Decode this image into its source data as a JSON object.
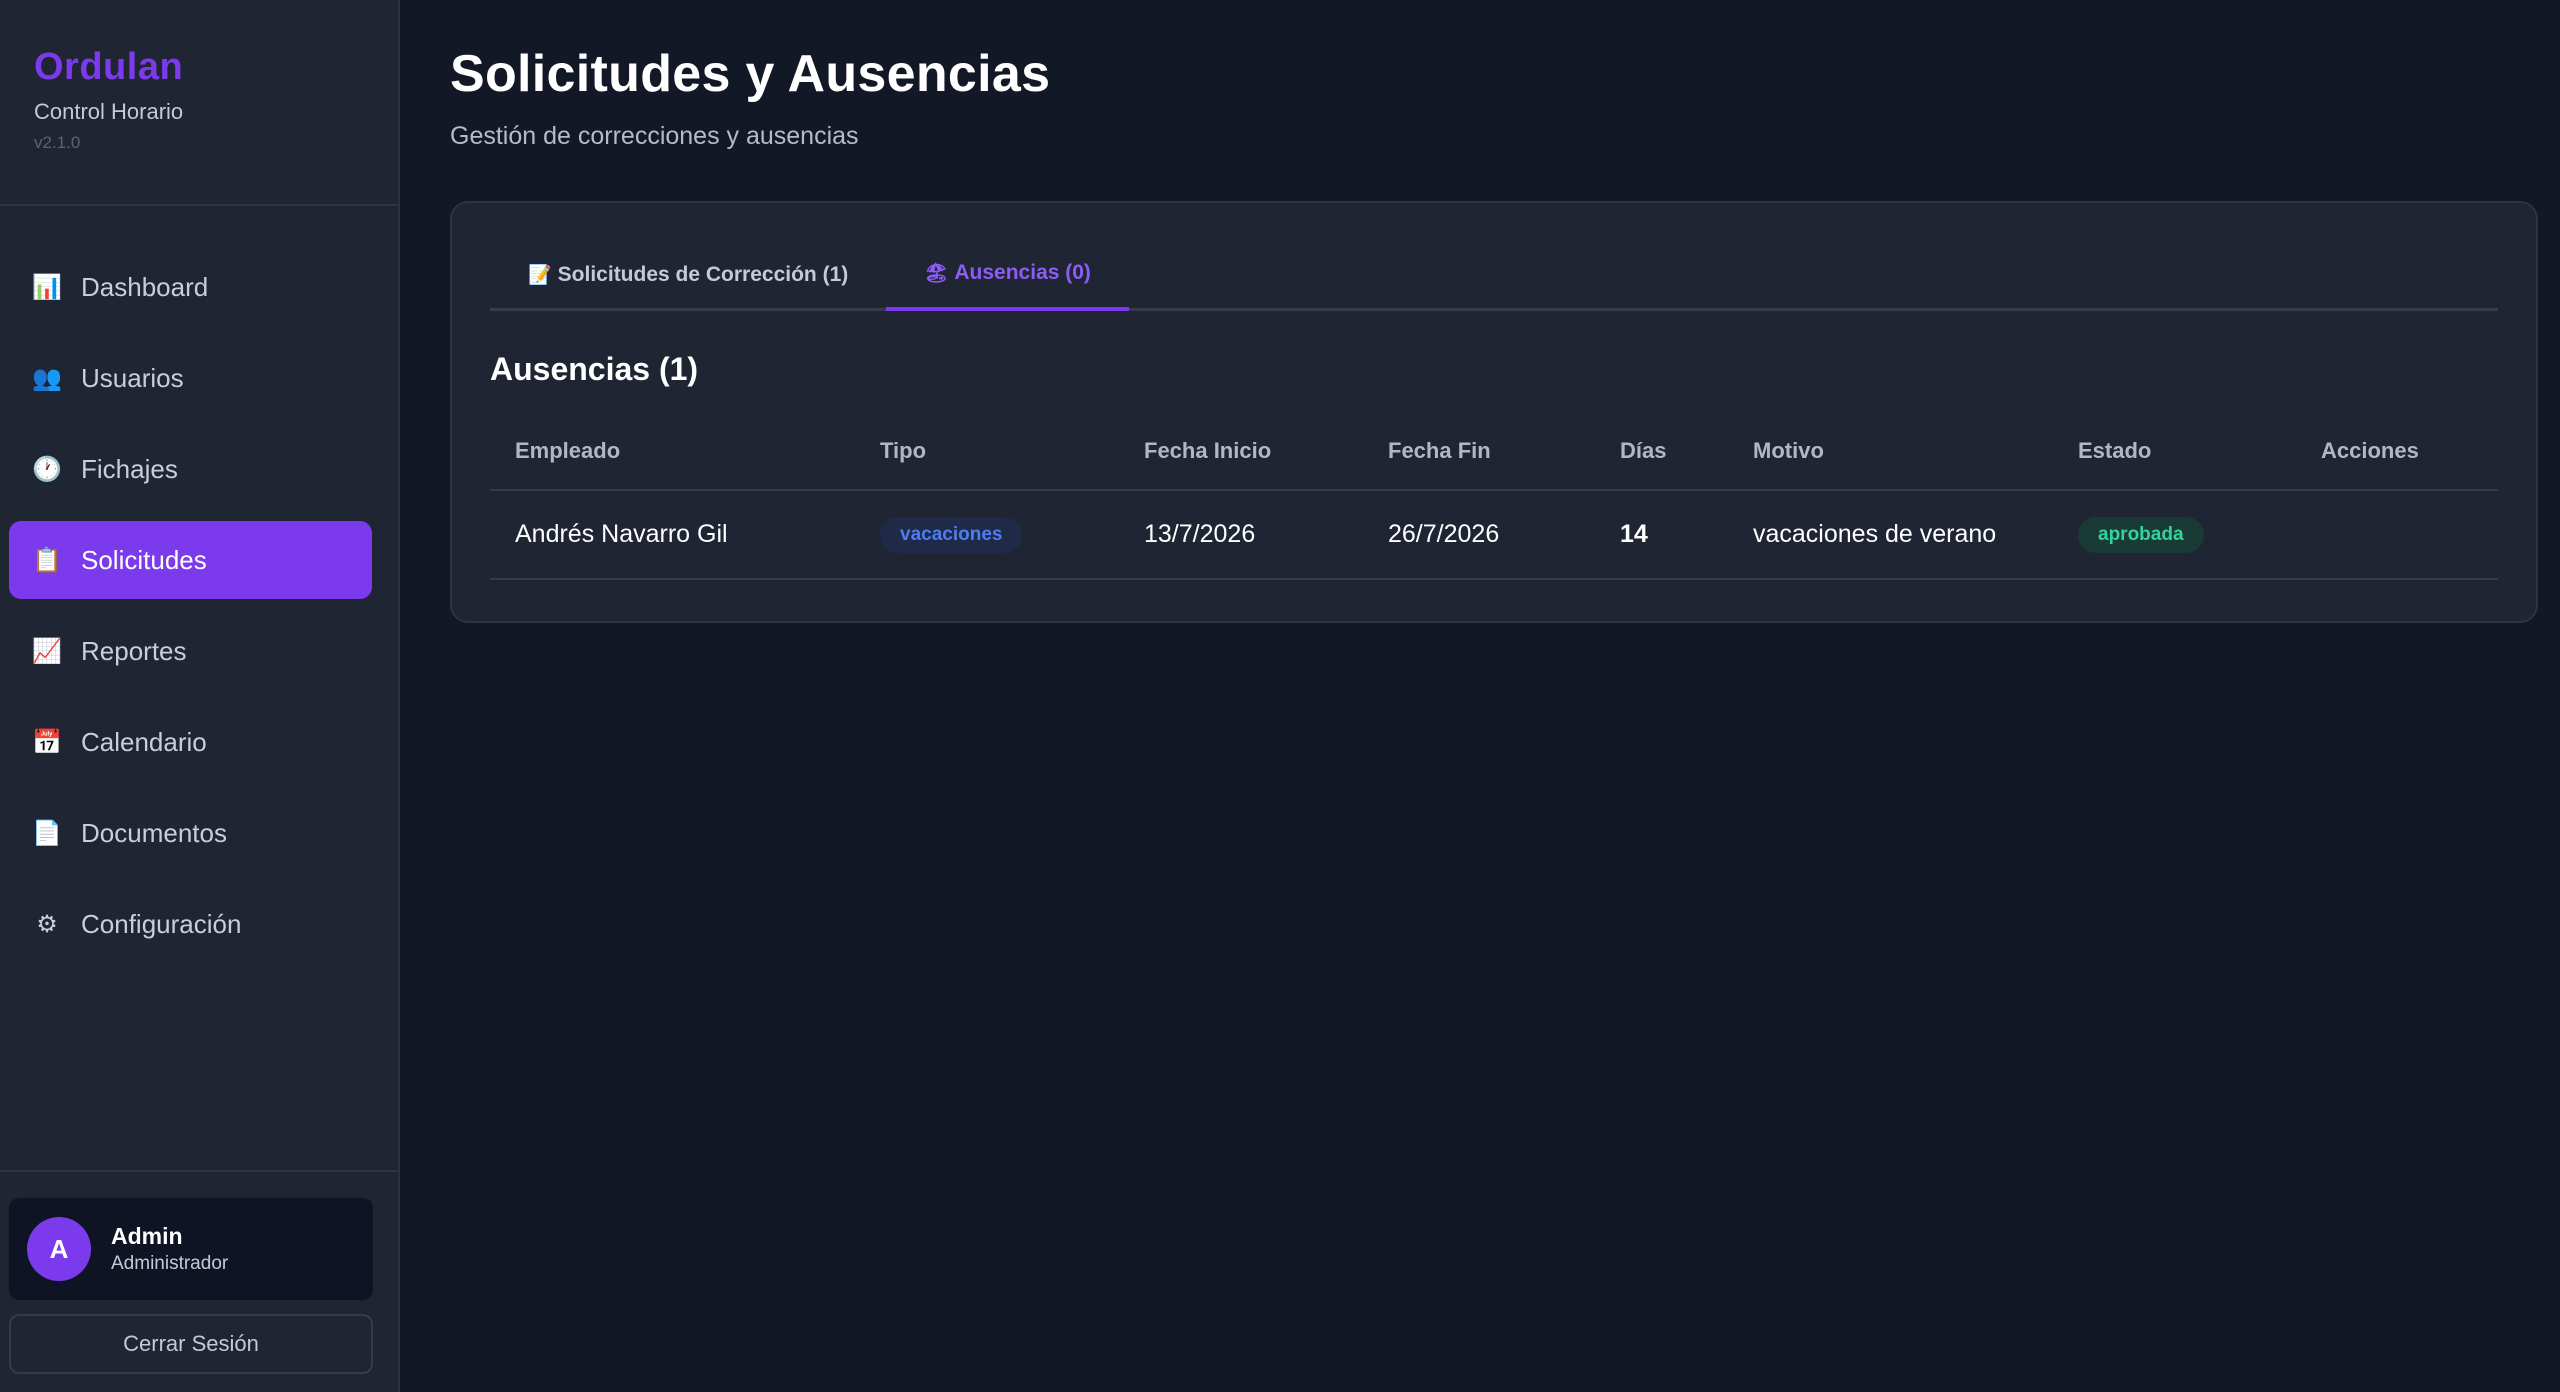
{
  "sidebar": {
    "brand": "Ordulan",
    "subtitle": "Control Horario",
    "version": "v2.1.0",
    "items": [
      {
        "label": "Dashboard",
        "icon": "📊"
      },
      {
        "label": "Usuarios",
        "icon": "👥"
      },
      {
        "label": "Fichajes",
        "icon": "🕐"
      },
      {
        "label": "Solicitudes",
        "icon": "📋",
        "active": true
      },
      {
        "label": "Reportes",
        "icon": "📈"
      },
      {
        "label": "Calendario",
        "icon": "📅"
      },
      {
        "label": "Documentos",
        "icon": "📄"
      },
      {
        "label": "Configuración",
        "icon": "⚙"
      }
    ],
    "user": {
      "initial": "A",
      "name": "Admin",
      "role": "Administrador"
    },
    "logout_label": "Cerrar Sesión"
  },
  "header": {
    "title": "Solicitudes y Ausencias",
    "subtitle": "Gestión de correcciones y ausencias"
  },
  "tabs": [
    {
      "icon": "📝",
      "label": "Solicitudes de Corrección (1)"
    },
    {
      "icon": "🏖",
      "label": "Ausencias (0)",
      "active": true
    }
  ],
  "section": {
    "title": "Ausencias (1)"
  },
  "table": {
    "headers": [
      "Empleado",
      "Tipo",
      "Fecha Inicio",
      "Fecha Fin",
      "Días",
      "Motivo",
      "Estado",
      "Acciones"
    ],
    "rows": [
      {
        "empleado": "Andrés Navarro Gil",
        "tipo": "vacaciones",
        "fecha_inicio": "13/7/2026",
        "fecha_fin": "26/7/2026",
        "dias": "14",
        "motivo": "vacaciones de verano",
        "estado": "aprobada",
        "acciones": ""
      }
    ]
  },
  "colors": {
    "accent": "#7c3aed",
    "background": "#121826",
    "panel": "#1f2533"
  }
}
